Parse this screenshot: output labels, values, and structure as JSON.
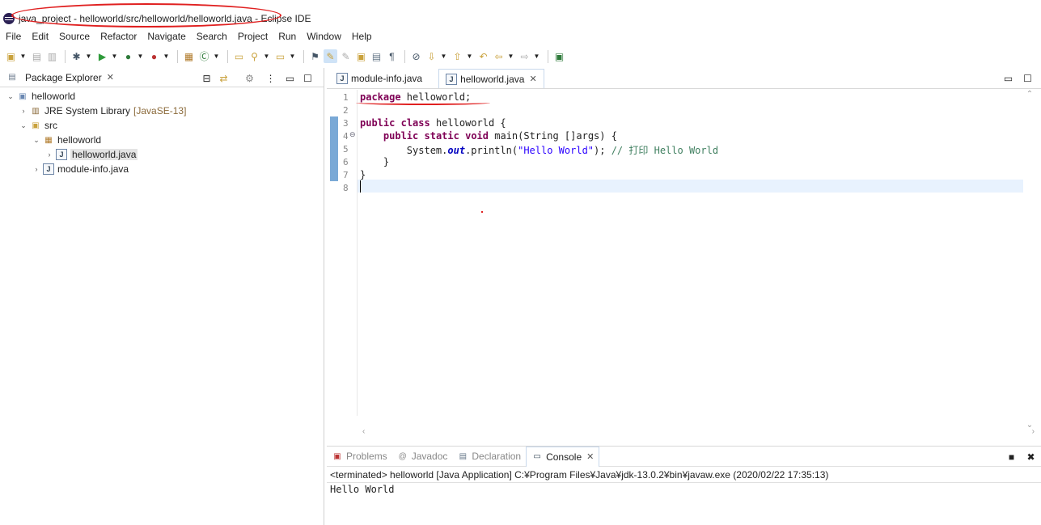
{
  "window": {
    "title": "java_project - helloworld/src/helloworld/helloworld.java - Eclipse IDE"
  },
  "menu": [
    "File",
    "Edit",
    "Source",
    "Refactor",
    "Navigate",
    "Search",
    "Project",
    "Run",
    "Window",
    "Help"
  ],
  "package_explorer": {
    "title": "Package Explorer",
    "tree": {
      "project": "helloworld",
      "jre": "JRE System Library",
      "jre_version": "[JavaSE-13]",
      "src": "src",
      "package": "helloworld",
      "file_main": "helloworld.java",
      "file_module": "module-info.java"
    }
  },
  "editor": {
    "tabs": [
      "module-info.java",
      "helloworld.java"
    ],
    "active_tab": "helloworld.java",
    "line_numbers": [
      "1",
      "2",
      "3",
      "4",
      "5",
      "6",
      "7",
      "8"
    ],
    "code": {
      "l1_kw": "package",
      "l1_rest": " helloworld;",
      "l3_kw1": "public",
      "l3_kw2": "class",
      "l3_rest": " helloworld {",
      "l4_kw1": "public",
      "l4_kw2": "static",
      "l4_kw3": "void",
      "l4_rest": " main(String []args) {",
      "l5_pre": "System.",
      "l5_field": "out",
      "l5_mid": ".println(",
      "l5_str": "\"Hello World\"",
      "l5_end": "); ",
      "l5_comment": "// 打印 Hello World",
      "l6": "}",
      "l7": "}"
    }
  },
  "console": {
    "tabs": [
      "Problems",
      "Javadoc",
      "Declaration",
      "Console"
    ],
    "active_tab": "Console",
    "status": "<terminated> helloworld [Java Application] C:¥Program Files¥Java¥jdk-13.0.2¥bin¥javaw.exe (2020/02/22 17:35:13)",
    "output": "Hello World"
  },
  "icons": {
    "app": "eclipse-icon",
    "view_close": "close-icon"
  },
  "colors": {
    "keyword": "#7f0055",
    "string": "#2a00ff",
    "comment": "#3f7f5f",
    "annotation": "#e02020"
  }
}
